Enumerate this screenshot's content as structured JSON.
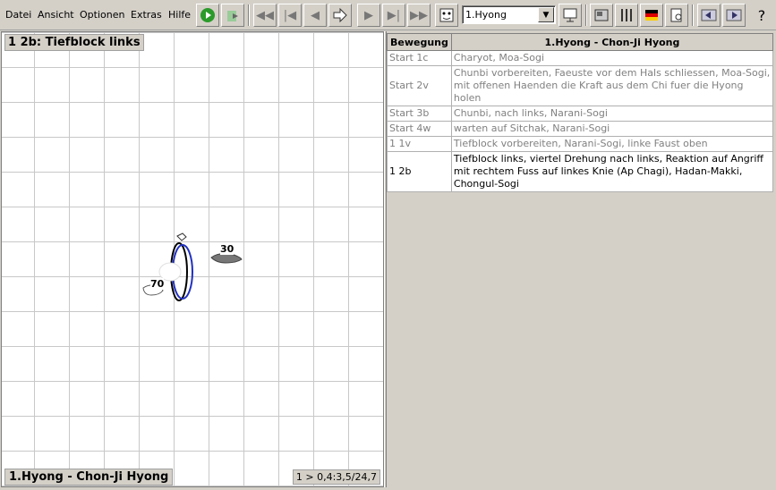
{
  "menu": [
    "Datei",
    "Ansicht",
    "Optionen",
    "Extras",
    "Hilfe"
  ],
  "toolbar": {
    "combo_value": "1.Hyong",
    "help_label": "?"
  },
  "board": {
    "title": "1 2b: Tiefblock links",
    "footer": "1.Hyong - Chon-Ji Hyong",
    "coords": "1 > 0,4:3,5/24,7",
    "foot_left_label": "70",
    "foot_right_label": "30"
  },
  "table": {
    "headers": [
      "Bewegung",
      "1.Hyong - Chon-Ji Hyong"
    ],
    "rows": [
      {
        "move": "Start 1c",
        "desc": "Charyot, Moa-Sogi"
      },
      {
        "move": "Start 2v",
        "desc": "Chunbi vorbereiten, Faeuste vor dem Hals schliessen, Moa-Sogi, mit offenen Haenden die Kraft aus dem Chi fuer die Hyong holen"
      },
      {
        "move": "Start 3b",
        "desc": "Chunbi, nach links, Narani-Sogi"
      },
      {
        "move": "Start 4w",
        "desc": "warten auf Sitchak, Narani-Sogi"
      },
      {
        "move": "1 1v",
        "desc": "Tiefblock vorbereiten, Narani-Sogi, linke Faust oben"
      },
      {
        "move": "1 2b",
        "desc": "Tiefblock links, viertel Drehung nach links, Reaktion auf Angriff mit rechtem Fuss auf linkes Knie (Ap Chagi), Hadan-Makki, Chongul-Sogi"
      }
    ],
    "active_row": 5
  },
  "colors": {
    "active_text": "#000000",
    "inactive_text": "#808080",
    "stance_blue": "#2030c0"
  }
}
